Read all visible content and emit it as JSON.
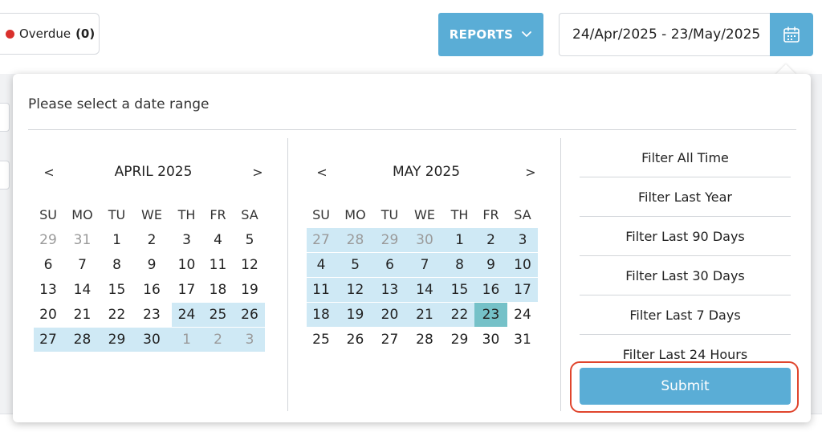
{
  "colors": {
    "accent": "#5aadd6",
    "overdue_dot": "#d9302c",
    "range_fill": "#cfe9f5",
    "selected_end": "#75c1c8",
    "highlight_ring": "#e0452d"
  },
  "toolbar": {
    "overdue_label": "Overdue",
    "overdue_count": "(0)",
    "reports_label": "REPORTS",
    "reports_icon": "chevron-down-icon",
    "date_range_value": "24/Apr/2025 - 23/May/2025",
    "calendar_icon": "calendar-icon"
  },
  "popup": {
    "title": "Please select a date range",
    "prev_symbol": "<",
    "next_symbol": ">",
    "weekdays": [
      "SU",
      "MO",
      "TU",
      "WE",
      "TH",
      "FR",
      "SA"
    ],
    "calendars": [
      {
        "month_label": "APRIL 2025",
        "days": [
          {
            "d": "29",
            "other": true,
            "in_range": false,
            "end": false
          },
          {
            "d": "31",
            "other": true,
            "in_range": false,
            "end": false
          },
          {
            "d": "1",
            "other": false,
            "in_range": false,
            "end": false
          },
          {
            "d": "2",
            "other": false,
            "in_range": false,
            "end": false
          },
          {
            "d": "3",
            "other": false,
            "in_range": false,
            "end": false
          },
          {
            "d": "4",
            "other": false,
            "in_range": false,
            "end": false
          },
          {
            "d": "5",
            "other": false,
            "in_range": false,
            "end": false
          },
          {
            "d": "6",
            "other": false,
            "in_range": false,
            "end": false
          },
          {
            "d": "7",
            "other": false,
            "in_range": false,
            "end": false
          },
          {
            "d": "8",
            "other": false,
            "in_range": false,
            "end": false
          },
          {
            "d": "9",
            "other": false,
            "in_range": false,
            "end": false
          },
          {
            "d": "10",
            "other": false,
            "in_range": false,
            "end": false
          },
          {
            "d": "11",
            "other": false,
            "in_range": false,
            "end": false
          },
          {
            "d": "12",
            "other": false,
            "in_range": false,
            "end": false
          },
          {
            "d": "13",
            "other": false,
            "in_range": false,
            "end": false
          },
          {
            "d": "14",
            "other": false,
            "in_range": false,
            "end": false
          },
          {
            "d": "15",
            "other": false,
            "in_range": false,
            "end": false
          },
          {
            "d": "16",
            "other": false,
            "in_range": false,
            "end": false
          },
          {
            "d": "17",
            "other": false,
            "in_range": false,
            "end": false
          },
          {
            "d": "18",
            "other": false,
            "in_range": false,
            "end": false
          },
          {
            "d": "19",
            "other": false,
            "in_range": false,
            "end": false
          },
          {
            "d": "20",
            "other": false,
            "in_range": false,
            "end": false
          },
          {
            "d": "21",
            "other": false,
            "in_range": false,
            "end": false
          },
          {
            "d": "22",
            "other": false,
            "in_range": false,
            "end": false
          },
          {
            "d": "23",
            "other": false,
            "in_range": false,
            "end": false
          },
          {
            "d": "24",
            "other": false,
            "in_range": true,
            "end": false
          },
          {
            "d": "25",
            "other": false,
            "in_range": true,
            "end": false
          },
          {
            "d": "26",
            "other": false,
            "in_range": true,
            "end": false
          },
          {
            "d": "27",
            "other": false,
            "in_range": true,
            "end": false
          },
          {
            "d": "28",
            "other": false,
            "in_range": true,
            "end": false
          },
          {
            "d": "29",
            "other": false,
            "in_range": true,
            "end": false
          },
          {
            "d": "30",
            "other": false,
            "in_range": true,
            "end": false
          },
          {
            "d": "1",
            "other": true,
            "in_range": true,
            "end": false
          },
          {
            "d": "2",
            "other": true,
            "in_range": true,
            "end": false
          },
          {
            "d": "3",
            "other": true,
            "in_range": true,
            "end": false
          }
        ]
      },
      {
        "month_label": "MAY 2025",
        "days": [
          {
            "d": "27",
            "other": true,
            "in_range": true,
            "end": false
          },
          {
            "d": "28",
            "other": true,
            "in_range": true,
            "end": false
          },
          {
            "d": "29",
            "other": true,
            "in_range": true,
            "end": false
          },
          {
            "d": "30",
            "other": true,
            "in_range": true,
            "end": false
          },
          {
            "d": "1",
            "other": false,
            "in_range": true,
            "end": false
          },
          {
            "d": "2",
            "other": false,
            "in_range": true,
            "end": false
          },
          {
            "d": "3",
            "other": false,
            "in_range": true,
            "end": false
          },
          {
            "d": "4",
            "other": false,
            "in_range": true,
            "end": false
          },
          {
            "d": "5",
            "other": false,
            "in_range": true,
            "end": false
          },
          {
            "d": "6",
            "other": false,
            "in_range": true,
            "end": false
          },
          {
            "d": "7",
            "other": false,
            "in_range": true,
            "end": false
          },
          {
            "d": "8",
            "other": false,
            "in_range": true,
            "end": false
          },
          {
            "d": "9",
            "other": false,
            "in_range": true,
            "end": false
          },
          {
            "d": "10",
            "other": false,
            "in_range": true,
            "end": false
          },
          {
            "d": "11",
            "other": false,
            "in_range": true,
            "end": false
          },
          {
            "d": "12",
            "other": false,
            "in_range": true,
            "end": false
          },
          {
            "d": "13",
            "other": false,
            "in_range": true,
            "end": false
          },
          {
            "d": "14",
            "other": false,
            "in_range": true,
            "end": false
          },
          {
            "d": "15",
            "other": false,
            "in_range": true,
            "end": false
          },
          {
            "d": "16",
            "other": false,
            "in_range": true,
            "end": false
          },
          {
            "d": "17",
            "other": false,
            "in_range": true,
            "end": false
          },
          {
            "d": "18",
            "other": false,
            "in_range": true,
            "end": false
          },
          {
            "d": "19",
            "other": false,
            "in_range": true,
            "end": false
          },
          {
            "d": "20",
            "other": false,
            "in_range": true,
            "end": false
          },
          {
            "d": "21",
            "other": false,
            "in_range": true,
            "end": false
          },
          {
            "d": "22",
            "other": false,
            "in_range": true,
            "end": false
          },
          {
            "d": "23",
            "other": false,
            "in_range": true,
            "end": true
          },
          {
            "d": "24",
            "other": false,
            "in_range": false,
            "end": false
          },
          {
            "d": "25",
            "other": false,
            "in_range": false,
            "end": false
          },
          {
            "d": "26",
            "other": false,
            "in_range": false,
            "end": false
          },
          {
            "d": "27",
            "other": false,
            "in_range": false,
            "end": false
          },
          {
            "d": "28",
            "other": false,
            "in_range": false,
            "end": false
          },
          {
            "d": "29",
            "other": false,
            "in_range": false,
            "end": false
          },
          {
            "d": "30",
            "other": false,
            "in_range": false,
            "end": false
          },
          {
            "d": "31",
            "other": false,
            "in_range": false,
            "end": false
          }
        ]
      }
    ],
    "quick_filters": [
      "Filter All Time",
      "Filter Last Year",
      "Filter Last 90 Days",
      "Filter Last 30 Days",
      "Filter Last 7 Days",
      "Filter Last 24 Hours"
    ],
    "submit_label": "Submit"
  }
}
